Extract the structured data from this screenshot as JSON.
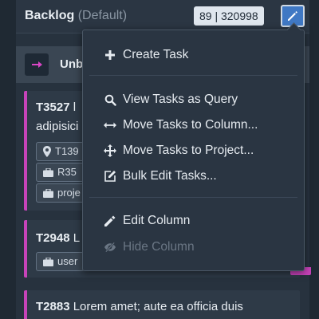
{
  "column": {
    "title": "Backlog",
    "default_label": "(Default)",
    "count": "89 | 320998"
  },
  "lane": {
    "label": "Unb"
  },
  "cards": [
    {
      "id": "T3527",
      "title_rest": "l",
      "line2": "adipisici",
      "tags": [
        "T139",
        "R35",
        "proje"
      ]
    },
    {
      "id": "T2948",
      "title_rest": "L",
      "tags": [
        "user"
      ]
    },
    {
      "id": "T2883",
      "title_rest": "Lorem amet; aute ea officia duis"
    }
  ],
  "menu": {
    "items": [
      {
        "label": "Create Task",
        "icon": "plus-icon"
      },
      {
        "label": "View Tasks as Query",
        "icon": "search-icon"
      },
      {
        "label": "Move Tasks to Column...",
        "icon": "arrows-horizontal-icon"
      },
      {
        "label": "Move Tasks to Project...",
        "icon": "move-arrows-icon"
      },
      {
        "label": "Bulk Edit Tasks...",
        "icon": "edit-square-icon"
      },
      {
        "label": "Edit Column",
        "icon": "pencil-icon"
      },
      {
        "label": "Hide Column",
        "icon": "eye-slash-icon",
        "disabled": true
      }
    ]
  },
  "colors": {
    "accent": "#3f78c4",
    "card_border": "#c743b9",
    "menu_bg": "#2a3542"
  }
}
